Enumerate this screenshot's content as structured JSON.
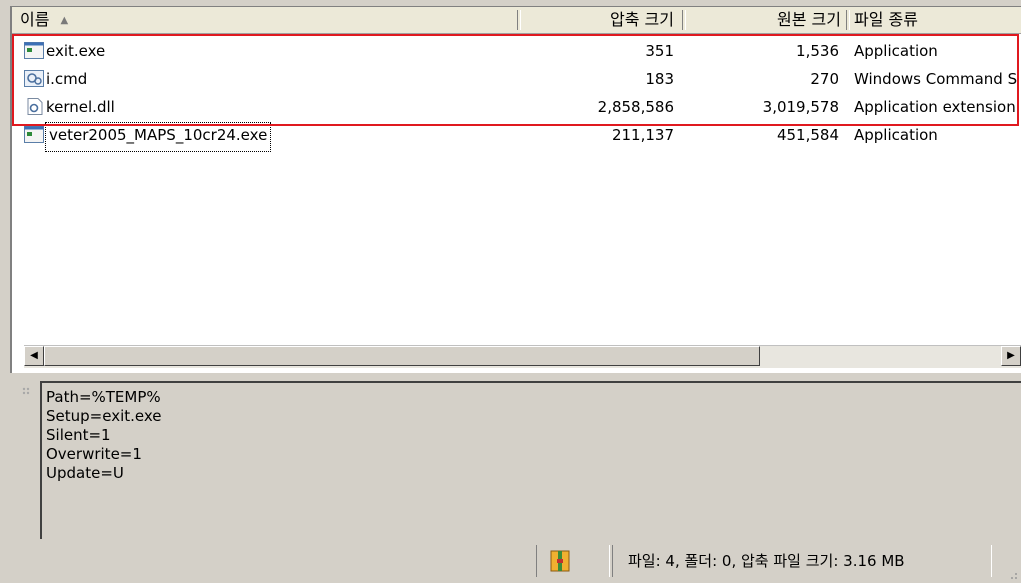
{
  "columns": {
    "name": "이름",
    "sort_indicator": "▲",
    "compressed": "압축 크기",
    "original": "원본 크기",
    "type": "파일 종류"
  },
  "files": [
    {
      "name": "exit.exe",
      "compressed": "351",
      "original": "1,536",
      "type": "Application",
      "icon": "exe-file-icon"
    },
    {
      "name": "i.cmd",
      "compressed": "183",
      "original": "270",
      "type": "Windows Command S",
      "icon": "cmd-file-icon"
    },
    {
      "name": "kernel.dll",
      "compressed": "2,858,586",
      "original": "3,019,578",
      "type": "Application extension",
      "icon": "dll-file-icon"
    },
    {
      "name": "veter2005_MAPS_10cr24.exe",
      "compressed": "211,137",
      "original": "451,584",
      "type": "Application",
      "icon": "exe-file-icon"
    }
  ],
  "comment_lines": [
    "Path=%TEMP%",
    "Setup=exit.exe",
    "Silent=1",
    "Overwrite=1",
    "Update=U"
  ],
  "status": {
    "summary": "파일: 4, 폴더: 0, 압축 파일 크기: 3.16 MB"
  },
  "colors": {
    "highlight_box": "#e0191f",
    "window_bg": "#d4d0c8"
  }
}
